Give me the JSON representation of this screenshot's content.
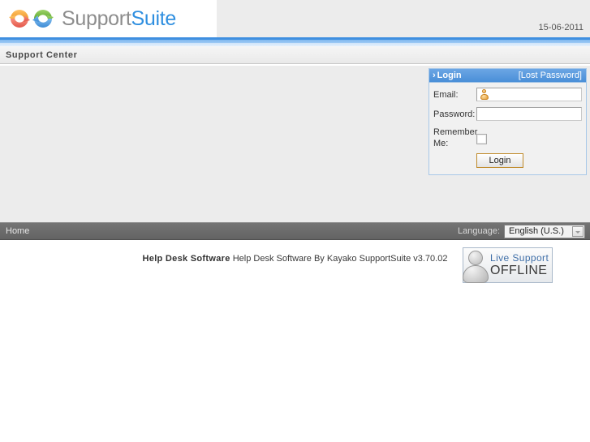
{
  "header": {
    "logo_icon": "recycle-arrows-logo-icon",
    "logo_text_part1": "Support",
    "logo_text_part2": "Suite",
    "date": "15-06-2011"
  },
  "title_bar": {
    "text": "Support Center"
  },
  "login_panel": {
    "chevron": "›",
    "title": "Login",
    "lost_password_link": "[Lost Password]",
    "email_label": "Email:",
    "email_value": "",
    "email_icon": "user-icon",
    "password_label": "Password:",
    "password_value": "",
    "remember_label": "Remember Me:",
    "remember_checked": false,
    "submit_label": "Login"
  },
  "live_support": {
    "icon": "person-silhouette-icon",
    "line1": "Live Support",
    "line2": "OFFLINE"
  },
  "footer_nav": {
    "home_label": "Home",
    "language_label": "Language:",
    "language_selected": "English (U.S.)",
    "language_options": [
      "English (U.S.)"
    ],
    "dropdown_icon": "chevron-down-icon"
  },
  "credit": {
    "bold_text": "Help Desk Software",
    "normal_text": "Help Desk Software By Kayako SupportSuite v3.70.02"
  },
  "colors": {
    "accent_blue": "#3f8fe0",
    "logo_blue": "#2f8fe0",
    "logo_gray": "#8d8d8d",
    "panel_bg": "#ececec",
    "footer_gray": "#6b6b6b",
    "button_border": "#c08b2b"
  }
}
